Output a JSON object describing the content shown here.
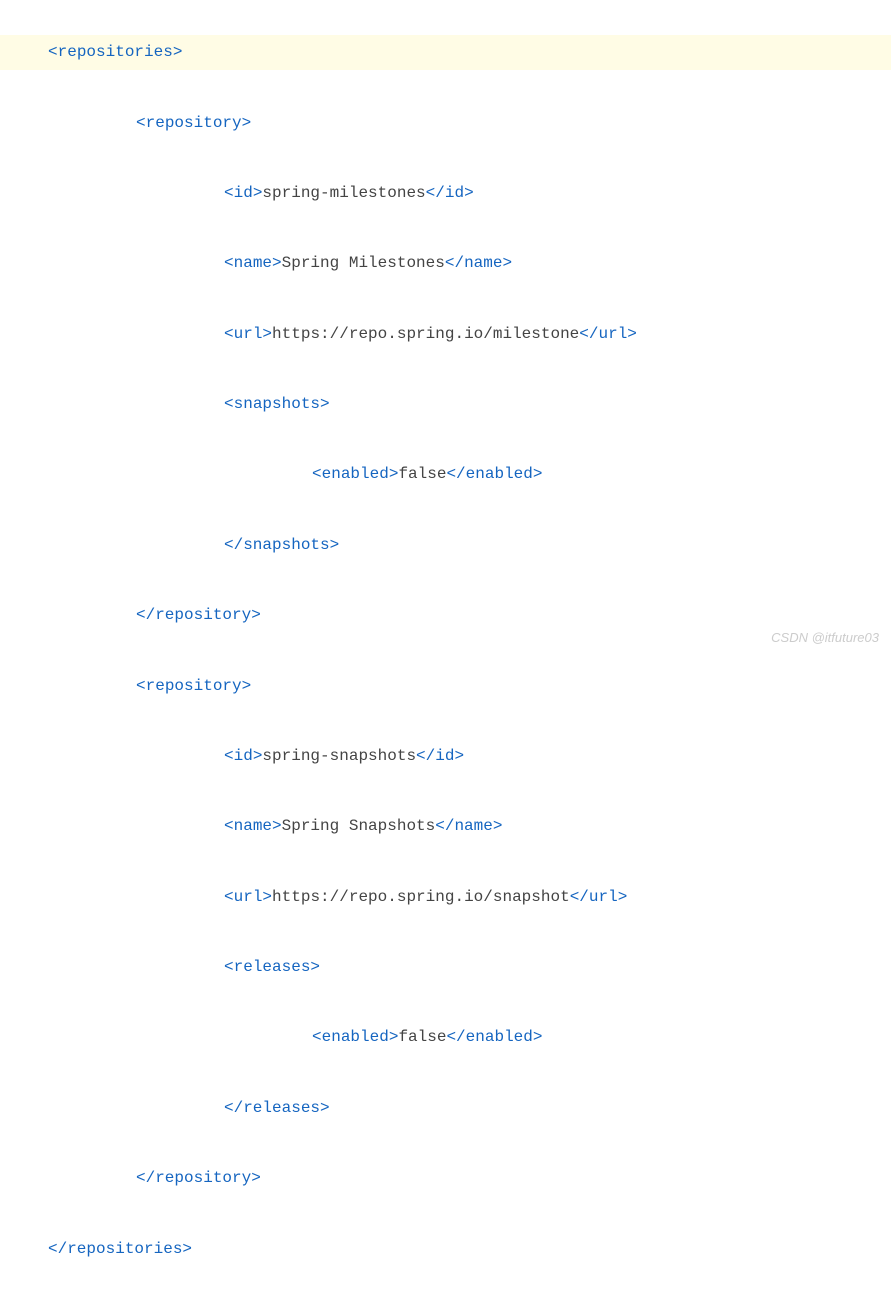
{
  "code": {
    "line1_tag": "repositories",
    "line2_tag": "repository",
    "line3_tag": "id",
    "line3_text": "spring-milestones",
    "line4_tag": "name",
    "line4_text": "Spring Milestones",
    "line5_tag": "url",
    "line5_text": "https://repo.spring.io/milestone",
    "line6_tag": "snapshots",
    "line7_tag": "enabled",
    "line7_text": "false",
    "line8_tag": "snapshots",
    "line9_tag": "repository",
    "line10_tag": "repository",
    "line11_tag": "id",
    "line11_text": "spring-snapshots",
    "line12_tag": "name",
    "line12_text": "Spring Snapshots",
    "line13_tag": "url",
    "line13_text": "https://repo.spring.io/snapshot",
    "line14_tag": "releases",
    "line15_tag": "enabled",
    "line15_text": "false",
    "line16_tag": "releases",
    "line17_tag": "repository",
    "line18_tag": "repositories"
  },
  "watermark": "CSDN @itfuture03"
}
